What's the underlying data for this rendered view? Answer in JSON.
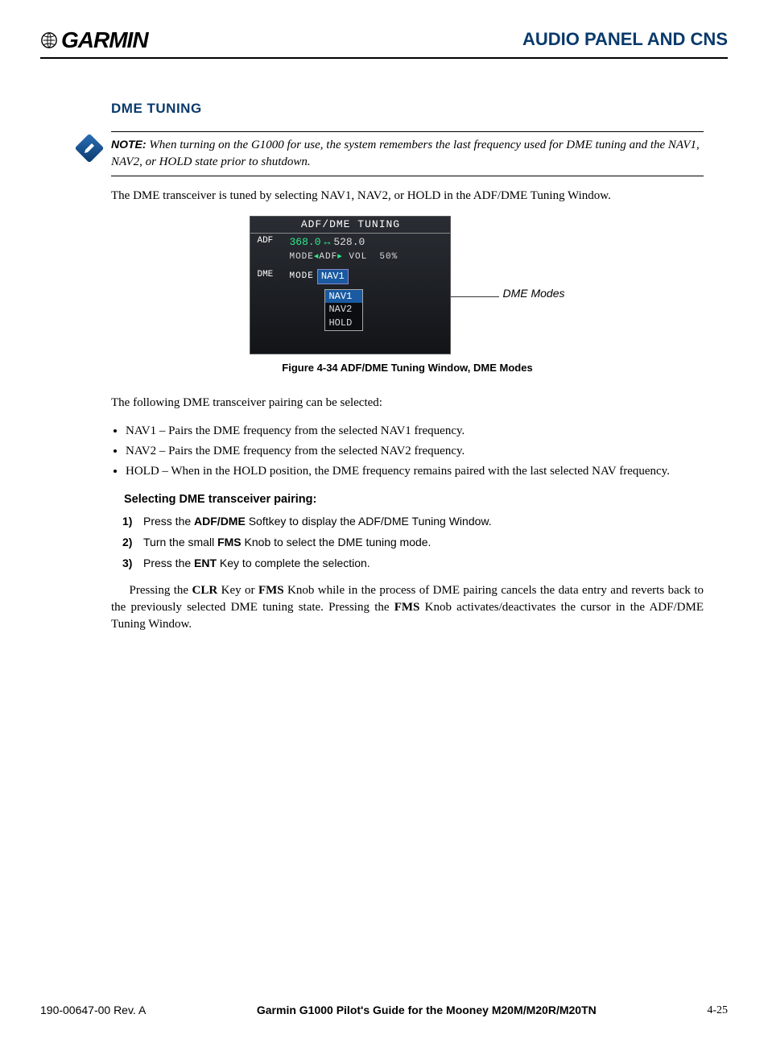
{
  "header": {
    "brand": "GARMIN",
    "section": "AUDIO PANEL AND CNS"
  },
  "subsection_title": "DME TUNING",
  "note": {
    "label": "NOTE:",
    "text": "When turning on the G1000 for use, the system remembers the last frequency used for DME tuning and the NAV1, NAV2, or HOLD state prior to shutdown."
  },
  "intro": "The DME transceiver is tuned by selecting NAV1, NAV2, or HOLD in the ADF/DME Tuning Window.",
  "tuning_window": {
    "title": "ADF/DME TUNING",
    "adf_label": "ADF",
    "adf_active": "368.0",
    "adf_arrow": "↔",
    "adf_standby": "528.0",
    "adf_mode_line": "MODE",
    "adf_mode_val": "ADF",
    "adf_vol_label": "VOL",
    "adf_vol_val": "50%",
    "dme_label": "DME",
    "dme_mode_label": "MODE",
    "dme_mode_sel": "NAV1",
    "dropdown": [
      "NAV1",
      "NAV2",
      "HOLD"
    ]
  },
  "callout": "DME Modes",
  "figure_caption": "Figure 4-34  ADF/DME Tuning Window, DME Modes",
  "pairing_intro": "The following DME transceiver pairing can be selected:",
  "bullets": [
    "NAV1 – Pairs the DME frequency from the selected NAV1 frequency.",
    "NAV2 – Pairs the DME frequency from the selected NAV2 frequency.",
    "HOLD – When in the HOLD position, the DME frequency remains paired with the last selected NAV frequency."
  ],
  "procedure_title": "Selecting DME transceiver pairing:",
  "steps": [
    {
      "pre": "Press the ",
      "b": "ADF/DME",
      "post": " Softkey to display the ADF/DME Tuning Window."
    },
    {
      "pre": "Turn the small ",
      "b": "FMS",
      "post": " Knob to select the DME tuning mode."
    },
    {
      "pre": "Press the ",
      "b": "ENT",
      "post": " Key to complete the selection."
    }
  ],
  "closing": {
    "t1": "Pressing the ",
    "b1": "CLR",
    "t2": " Key or ",
    "b2": "FMS",
    "t3": " Knob while in the process of DME pairing cancels the data entry and reverts back to the previously selected DME tuning state.  Pressing the ",
    "b3": "FMS",
    "t4": " Knob activates/deactivates the cursor in the ADF/DME Tuning Window."
  },
  "footer": {
    "left": "190-00647-00  Rev. A",
    "center": "Garmin G1000 Pilot's Guide for the Mooney M20M/M20R/M20TN",
    "right": "4-25"
  }
}
